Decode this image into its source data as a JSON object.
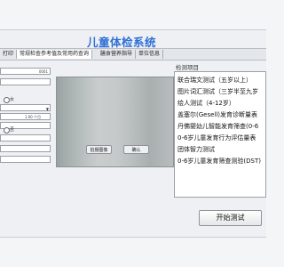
{
  "app": {
    "title": "儿童体检系统"
  },
  "tabs": [
    {
      "label": "打印"
    },
    {
      "label": "常规检查参考值及常用药查询"
    },
    {
      "label": "膳食营养指导"
    },
    {
      "label": "单位信息"
    }
  ],
  "form": {
    "id_value": "0001",
    "radio1_label": "女",
    "age_value": "1.00 个月",
    "radio2_label": "否"
  },
  "camera": {
    "capture_label": "拍摄图像",
    "confirm_label": "确认"
  },
  "items_panel": {
    "label": "检测项目",
    "items": [
      "联合瑞文测试（五岁以上）",
      "图片词汇测试（三岁半至九岁",
      "绘人测试（4-12岁）",
      "盖塞尔(Gesell)发育诊断量表",
      "丹佛婴幼儿智能发育筛查(0-6",
      "0-6岁儿童发育行为评估量表",
      "团体智力测试",
      "0-6岁儿童发育筛查测验(DST)"
    ]
  },
  "actions": {
    "start_label": "开始测试"
  },
  "colors": {
    "title": "#2f6fd6"
  }
}
